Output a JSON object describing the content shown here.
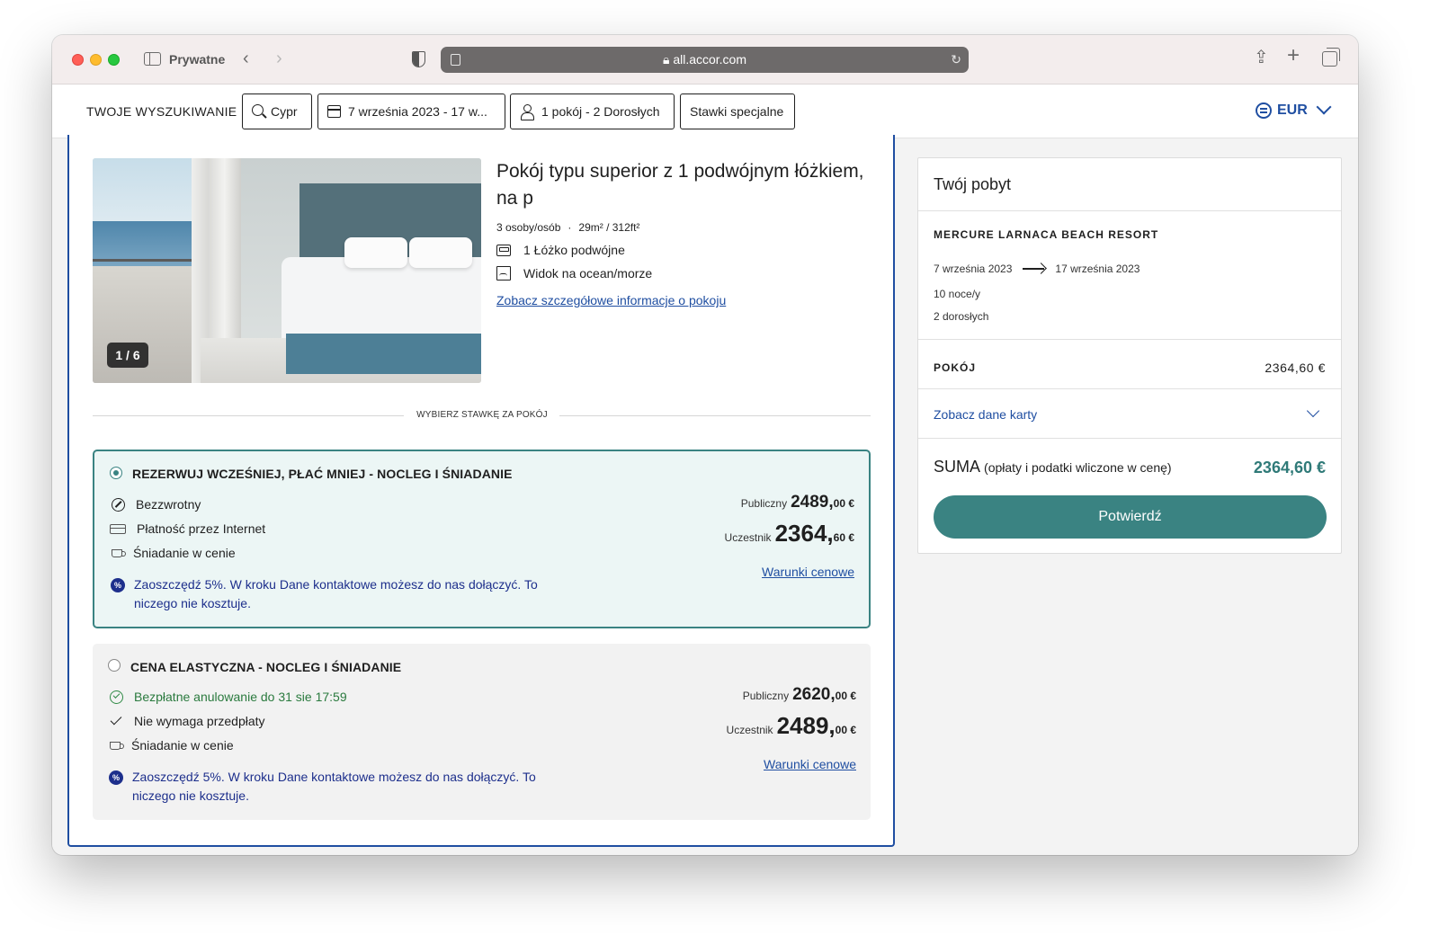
{
  "browser": {
    "private_label": "Prywatne",
    "url": "all.accor.com"
  },
  "search": {
    "label": "TWOJE WYSZUKIWANIE",
    "destination": "Cypr",
    "dates": "7 września 2023 - 17 w...",
    "guests": "1 pokój - 2 Dorosłych",
    "special_rates": "Stawki specjalne",
    "currency": "EUR"
  },
  "room": {
    "photo_counter": "1 / 6",
    "title": "Pokój typu superior z 1 podwójnym łóżkiem, na p",
    "occupancy": "3 osoby/osób",
    "meta_dot": "·",
    "size": "29m² / 312ft²",
    "features": [
      "1 Łóżko podwójne",
      "Widok na ocean/morze"
    ],
    "details_link": "Zobacz szczegółowe informacje o pokoju",
    "choose_rate_label": "WYBIERZ STAWKĘ ZA POKÓJ"
  },
  "rates": [
    {
      "name": "REZERWUJ WCZEŚNIEJ, PŁAĆ MNIEJ - NOCLEG I ŚNIADANIE",
      "selected": true,
      "lines": [
        "Bezzwrotny",
        "Płatność przez Internet",
        "Śniadanie w cenie"
      ],
      "promo": "Zaoszczędź 5%. W kroku Dane kontaktowe możesz do nas dołączyć. To niczego nie kosztuje.",
      "public_label": "Publiczny",
      "public_int": "2489,",
      "public_dec": "00 €",
      "member_label": "Uczestnik",
      "member_int": "2364,",
      "member_dec": "60 €",
      "conditions": "Warunki cenowe"
    },
    {
      "name": "CENA ELASTYCZNA - NOCLEG I ŚNIADANIE",
      "selected": false,
      "lines": [
        "Bezpłatne anulowanie do 31 sie 17:59",
        "Nie wymaga przedpłaty",
        "Śniadanie w cenie"
      ],
      "promo": "Zaoszczędź 5%. W kroku Dane kontaktowe możesz do nas dołączyć. To niczego nie kosztuje.",
      "public_label": "Publiczny",
      "public_int": "2620,",
      "public_dec": "00 €",
      "member_label": "Uczestnik",
      "member_int": "2489,",
      "member_dec": "00 €",
      "conditions": "Warunki cenowe"
    }
  ],
  "summary": {
    "title": "Twój pobyt",
    "hotel": "MERCURE LARNACA BEACH RESORT",
    "checkin": "7 września 2023",
    "checkout": "17 września 2023",
    "nights": "10 noce/y",
    "adults": "2 dorosłych",
    "room_label": "POKÓJ",
    "room_price": "2364,60 €",
    "card_details": "Zobacz dane karty",
    "total_label": "SUMA",
    "total_note": "(opłaty i podatki wliczone w cenę)",
    "total_value": "2364,60 €",
    "confirm": "Potwierdź"
  },
  "colors": {
    "accent_teal": "#3a8382",
    "brand_blue": "#1f4ea1",
    "promo_navy": "#1d2f8c",
    "success_green": "#2a7a3e"
  }
}
